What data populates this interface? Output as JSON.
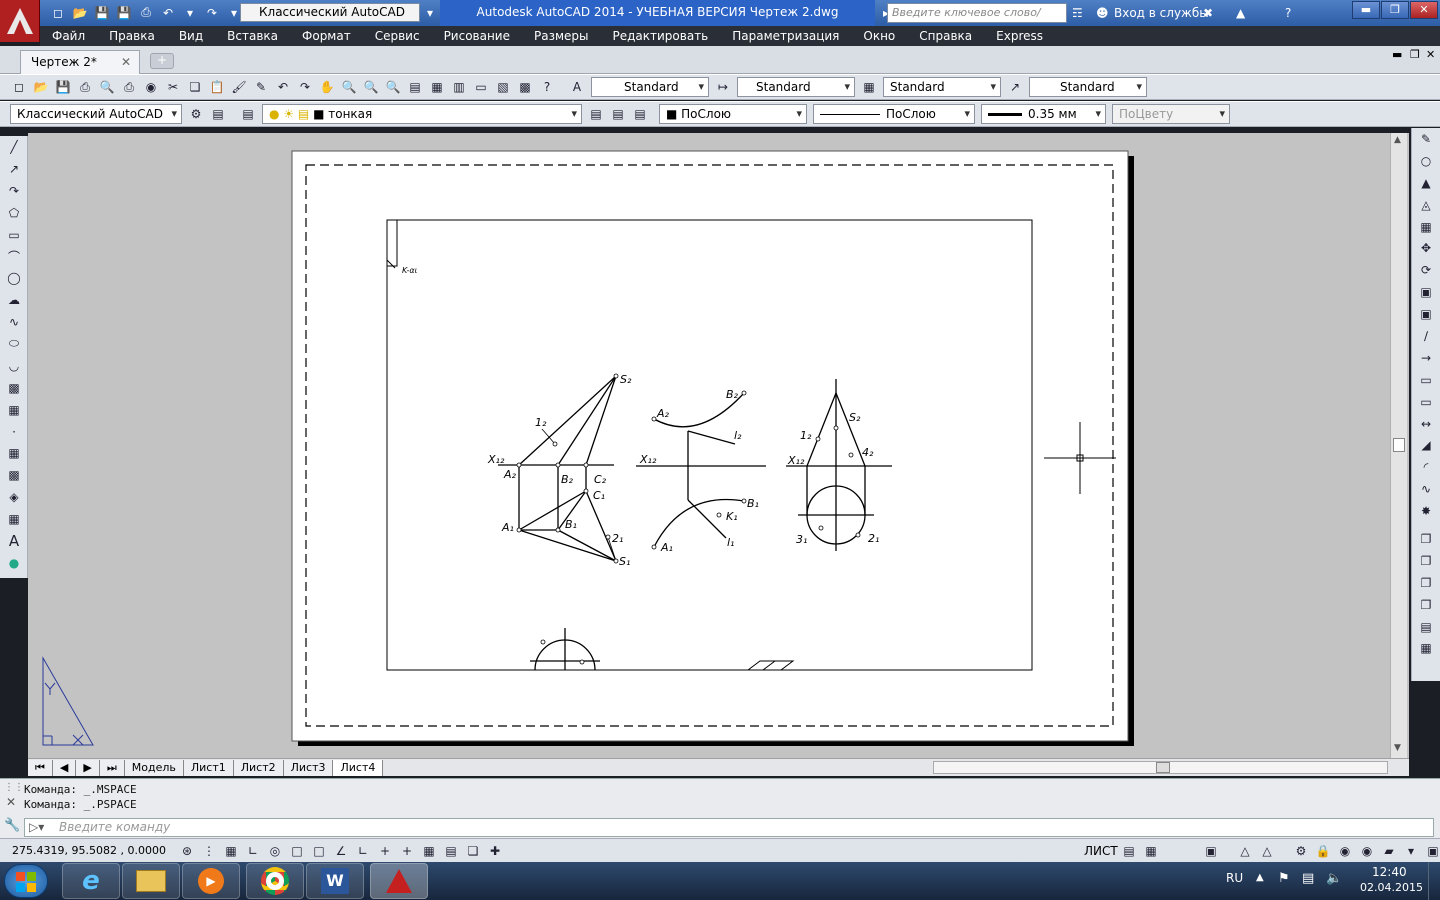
{
  "app": {
    "title": "Autodesk AutoCAD 2014 - УЧЕБНАЯ ВЕРСИЯ    Чертеж 2.dwg",
    "workspace": "Классический AutoCAD",
    "search_placeholder": "Введите ключевое слово/фразу",
    "signin": "Вход в службы",
    "help": "?"
  },
  "menu": [
    "Файл",
    "Правка",
    "Вид",
    "Вставка",
    "Формат",
    "Сервис",
    "Рисование",
    "Размеры",
    "Редактировать",
    "Параметризация",
    "Окно",
    "Справка",
    "Express"
  ],
  "doc_tab": "Чертеж 2*",
  "styles": {
    "text": "Standard",
    "dim": "Standard",
    "table": "Standard",
    "mleader": "Standard"
  },
  "layers": {
    "workspace": "Классический AutoCAD",
    "current_layer": "тонкая",
    "color": "ПоСлою",
    "linetype": "ПоСлою",
    "lineweight": "0.35 мм",
    "plotstyle": "ПоЦвету"
  },
  "layout_tabs": [
    "Модель",
    "Лист1",
    "Лист2",
    "Лист3",
    "Лист4"
  ],
  "active_layout": "Лист4",
  "command": {
    "history": [
      "Команда:  _.MSPACE",
      "Команда:  _.PSPACE"
    ],
    "placeholder": "Введите команду"
  },
  "status": {
    "coords": "275.4319,  95.5082 , 0.0000",
    "space": "ЛИСТ"
  },
  "taskbar": {
    "lang": "RU",
    "time": "12:40",
    "date": "02.04.2015"
  },
  "drawing": {
    "title_cell": "K-αι",
    "labels": {
      "s2": "S₂",
      "one2": "1₂",
      "x12a": "X₁₂",
      "a2": "A₂",
      "b2": "B₂",
      "c2": "C₂",
      "c1": "C₁",
      "a1": "A₁",
      "b1": "B₁",
      "two1": "2₁",
      "s1": "S₁",
      "a2b": "A₂",
      "b2b": "B₂",
      "l2": "l₂",
      "x12b": "X₁₂",
      "b1b": "B₁",
      "k1": "K₁",
      "a1b": "A₁",
      "l1": "l₁",
      "s2c": "S₂",
      "one2c": "1₂",
      "four2": "4₂",
      "x12c": "X₁₂",
      "three1": "3₁",
      "two1c": "2₁"
    }
  }
}
